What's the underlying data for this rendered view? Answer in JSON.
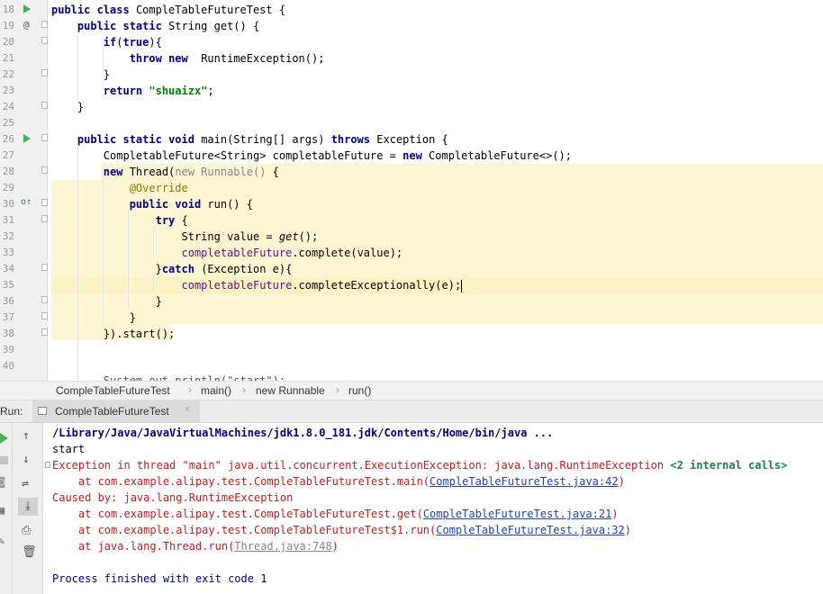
{
  "editor": {
    "line_numbers": [
      "18",
      "19",
      "20",
      "21",
      "22",
      "23",
      "24",
      "25",
      "26",
      "27",
      "28",
      "29",
      "30",
      "31",
      "32",
      "33",
      "34",
      "35",
      "36",
      "37",
      "38",
      "39",
      "40"
    ],
    "lines": [
      [
        [
          "kw",
          "public "
        ],
        [
          "kw",
          "class "
        ],
        [
          "",
          "CompleTableFutureTest {"
        ]
      ],
      [
        [
          "",
          "    "
        ],
        [
          "kw",
          "public "
        ],
        [
          "kw",
          "static "
        ],
        [
          "",
          "String get() {"
        ]
      ],
      [
        [
          "",
          "        "
        ],
        [
          "kw",
          "if"
        ],
        [
          "",
          "("
        ],
        [
          "kw",
          "true"
        ],
        [
          "",
          "){"
        ]
      ],
      [
        [
          "",
          "            "
        ],
        [
          "kw",
          "throw "
        ],
        [
          "kw",
          "new  "
        ],
        [
          "",
          "RuntimeException();"
        ]
      ],
      [
        [
          "",
          "        }"
        ]
      ],
      [
        [
          "",
          "        "
        ],
        [
          "kw",
          "return "
        ],
        [
          "str",
          "\"shuaizx\""
        ],
        [
          "",
          ";"
        ]
      ],
      [
        [
          "",
          "    }"
        ]
      ],
      [
        [
          "",
          ""
        ]
      ],
      [
        [
          "",
          "    "
        ],
        [
          "kw",
          "public "
        ],
        [
          "kw",
          "static "
        ],
        [
          "kw",
          "void "
        ],
        [
          "",
          "main(String[] args) "
        ],
        [
          "kw",
          "throws "
        ],
        [
          "",
          "Exception {"
        ]
      ],
      [
        [
          "",
          "        CompletableFuture<String> completableFuture = "
        ],
        [
          "kw",
          "new "
        ],
        [
          "",
          "CompletableFuture<>();"
        ]
      ],
      [
        [
          "",
          "        "
        ],
        [
          "kw",
          "new "
        ],
        [
          "",
          "Thread("
        ],
        [
          "gray",
          "new Runnable() "
        ],
        [
          "",
          "{"
        ]
      ],
      [
        [
          "",
          "            "
        ],
        [
          "ann",
          "@Override"
        ]
      ],
      [
        [
          "",
          "            "
        ],
        [
          "kw",
          "public "
        ],
        [
          "kw",
          "void "
        ],
        [
          "",
          "run() {"
        ]
      ],
      [
        [
          "",
          "                "
        ],
        [
          "kw",
          "try "
        ],
        [
          "",
          "{"
        ]
      ],
      [
        [
          "",
          "                    String value = "
        ],
        [
          "ital",
          "get"
        ],
        [
          "",
          "();"
        ]
      ],
      [
        [
          "",
          "                    "
        ],
        [
          "field",
          "completableFuture"
        ],
        [
          "",
          ".complete(value);"
        ]
      ],
      [
        [
          "",
          "                }"
        ],
        [
          "kw",
          "catch "
        ],
        [
          "",
          "(Exception e){"
        ]
      ],
      [
        [
          "",
          "                    "
        ],
        [
          "field",
          "completableFuture"
        ],
        [
          "",
          ".completeExceptionally(e);"
        ]
      ],
      [
        [
          "",
          "                }"
        ]
      ],
      [
        [
          "",
          "            }"
        ]
      ],
      [
        [
          "",
          "        })"
        ],
        [
          "",
          ".start();"
        ]
      ],
      [
        [
          "",
          ""
        ]
      ],
      [
        [
          "",
          ""
        ]
      ]
    ],
    "partial_line": "        System.out.println(\"start\");"
  },
  "breadcrumb": [
    "CompleTableFutureTest",
    "main()",
    "new Runnable",
    "run()"
  ],
  "run_panel": {
    "label": "Run:",
    "tab_title": "CompleTableFutureTest",
    "tab_close": "×"
  },
  "console": {
    "cmd": "/Library/Java/JavaVirtualMachines/jdk1.8.0_181.jdk/Contents/Home/bin/java ...",
    "start": "start",
    "exception_line": "Exception in thread \"main\" java.util.concurrent.ExecutionException: java.lang.RuntimeException ",
    "internal_calls": "<2 internal calls>",
    "at_prefix": "    at ",
    "frame1_method": "com.example.alipay.test.CompleTableFutureTest.main(",
    "frame1_link": "CompleTableFutureTest.java:42",
    "caused_by": "Caused by: java.lang.RuntimeException",
    "frame2_method": "com.example.alipay.test.CompleTableFutureTest.get(",
    "frame2_link": "CompleTableFutureTest.java:21",
    "frame3_method": "com.example.alipay.test.CompleTableFutureTest$1.run(",
    "frame3_link": "CompleTableFutureTest.java:32",
    "frame4_method": "java.lang.Thread.run(",
    "frame4_link": "Thread.java:748",
    "close_paren": ")",
    "finished": "Process finished with exit code 1"
  }
}
